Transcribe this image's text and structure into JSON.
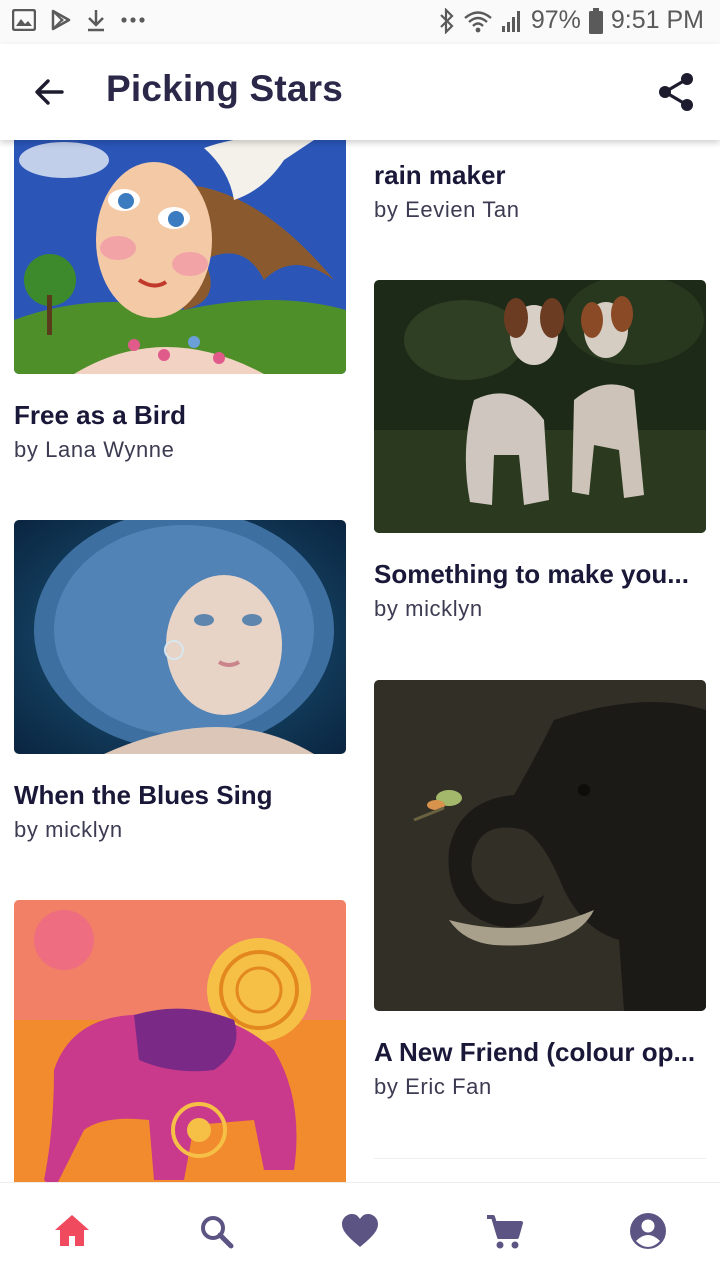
{
  "status_bar": {
    "battery": "97%",
    "time": "9:51 PM"
  },
  "app_bar": {
    "title": "Picking Stars"
  },
  "artworks": [
    {
      "title": "rain maker",
      "artist": "by Eevien Tan"
    },
    {
      "title": "Free as a Bird",
      "artist": "by Lana Wynne"
    },
    {
      "title": "Something to make you...",
      "artist": "by micklyn"
    },
    {
      "title": "When the Blues Sing",
      "artist": "by micklyn"
    },
    {
      "title": "A New Friend (colour op...",
      "artist": "by Eric Fan"
    }
  ],
  "nav": {
    "items": [
      "home-icon",
      "search-icon",
      "heart-icon",
      "cart-icon",
      "account-icon"
    ],
    "active_color": "#f04a5f",
    "inactive_color": "#5c5583"
  }
}
